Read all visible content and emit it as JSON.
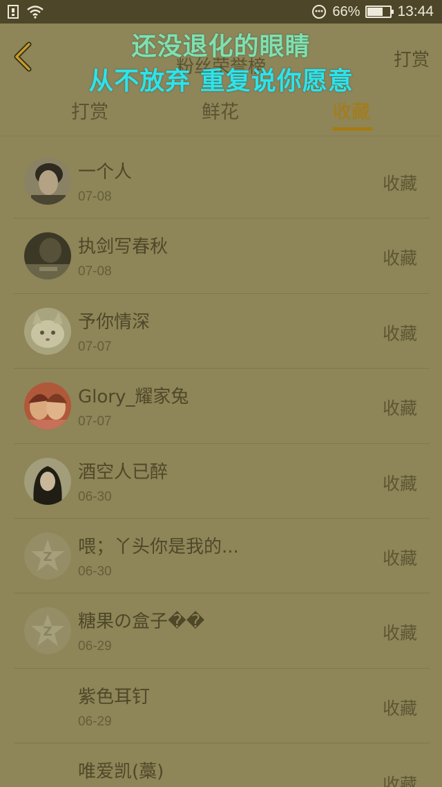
{
  "status_bar": {
    "battery_percent": "66%",
    "time": "13:44",
    "battery_level": 0.66,
    "icons": [
      "notification-icon",
      "wifi-icon",
      "emoji-icon",
      "battery-icon"
    ]
  },
  "header": {
    "title": "粉丝荣誉榜",
    "right_action": "打赏",
    "back_icon": "chevron-left-icon"
  },
  "lyrics": {
    "line1": "还没退化的眼睛",
    "line2": "从不放弃 重复说你愿意"
  },
  "tabs": [
    {
      "label": "打赏",
      "active": false
    },
    {
      "label": "鲜花",
      "active": false
    },
    {
      "label": "收藏",
      "active": true
    }
  ],
  "accent_color": "#a87b11",
  "rows": [
    {
      "name": "一个人",
      "date": "07-08",
      "action": "收藏",
      "avatar": "portrait-man"
    },
    {
      "name": "执剑写春秋",
      "date": "07-08",
      "action": "收藏",
      "avatar": "portrait-dark"
    },
    {
      "name": "予你情深",
      "date": "07-07",
      "action": "收藏",
      "avatar": "kitten"
    },
    {
      "name": "Glory_耀家兔",
      "date": "07-07",
      "action": "收藏",
      "avatar": "couple"
    },
    {
      "name": "酒空人已醉",
      "date": "06-30",
      "action": "收藏",
      "avatar": "portrait-woman"
    },
    {
      "name": "喂；丫头你是我的...",
      "date": "06-30",
      "action": "收藏",
      "avatar": "default-star"
    },
    {
      "name": "糖果の盒子��",
      "date": "06-29",
      "action": "收藏",
      "avatar": "default-star"
    },
    {
      "name": "紫色耳钉",
      "date": "06-29",
      "action": "收藏",
      "avatar": "none"
    },
    {
      "name": "唯爱凯(藁)",
      "date": "",
      "action": "收藏",
      "avatar": "none"
    }
  ]
}
